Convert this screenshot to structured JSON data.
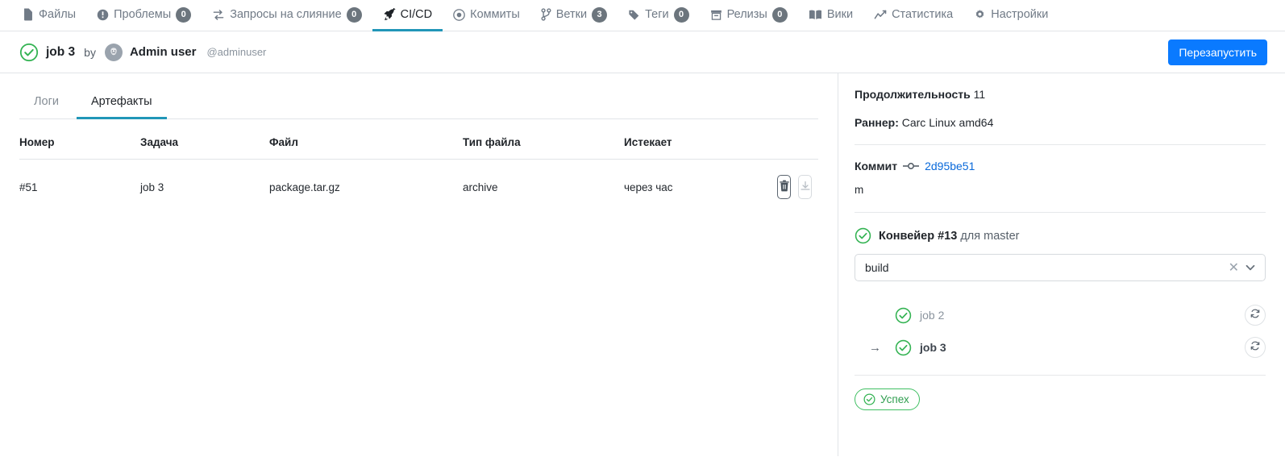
{
  "nav": {
    "items": [
      {
        "label": "Файлы",
        "icon": "file-icon",
        "badge": null,
        "active": false
      },
      {
        "label": "Проблемы",
        "icon": "issue-icon",
        "badge": "0",
        "active": false
      },
      {
        "label": "Запросы на слияние",
        "icon": "pull-request-icon",
        "badge": "0",
        "active": false
      },
      {
        "label": "CI/CD",
        "icon": "rocket-icon",
        "badge": null,
        "active": true
      },
      {
        "label": "Коммиты",
        "icon": "commit-dot-icon",
        "badge": null,
        "active": false
      },
      {
        "label": "Ветки",
        "icon": "branch-icon",
        "badge": "3",
        "active": false
      },
      {
        "label": "Теги",
        "icon": "tag-icon",
        "badge": "0",
        "active": false
      },
      {
        "label": "Релизы",
        "icon": "release-icon",
        "badge": "0",
        "active": false
      },
      {
        "label": "Вики",
        "icon": "book-icon",
        "badge": null,
        "active": false
      },
      {
        "label": "Статистика",
        "icon": "chart-icon",
        "badge": null,
        "active": false
      },
      {
        "label": "Настройки",
        "icon": "gear-icon",
        "badge": null,
        "active": false
      }
    ]
  },
  "header": {
    "status_icon": "check-circle-icon",
    "job_title": "job 3",
    "by": "by",
    "avatar_icon": "avatar-icon",
    "user_name": "Admin user",
    "user_handle": "@adminuser",
    "restart_label": "Перезапустить"
  },
  "tabs": [
    {
      "label": "Логи",
      "active": false
    },
    {
      "label": "Артефакты",
      "active": true
    }
  ],
  "artifacts": {
    "columns": [
      "Номер",
      "Задача",
      "Файл",
      "Тип файла",
      "Истекает",
      ""
    ],
    "rows": [
      {
        "number": "#51",
        "task": "job 3",
        "file": "package.tar.gz",
        "file_type": "archive",
        "expires": "через час",
        "delete_icon": "trash-icon",
        "download_icon": "download-icon"
      }
    ]
  },
  "sidebar": {
    "duration_label": "Продолжительность",
    "duration_value": "11",
    "runner_label": "Раннер:",
    "runner_value": "Carc Linux amd64",
    "commit_label": "Коммит",
    "commit_icon": "git-commit-icon",
    "commit_sha": "2d95be51",
    "commit_message": "m",
    "pipeline_status_icon": "check-circle-icon",
    "pipeline_title": "Конвейер #13",
    "pipeline_for": "для master",
    "stage_select": {
      "value": "build",
      "placeholder": "build",
      "clear_icon": "clear-icon",
      "chevron_icon": "chevron-down-icon"
    },
    "jobs": [
      {
        "name": "job 2",
        "status_icon": "check-circle-icon",
        "current": false,
        "arrow": "",
        "rerun_icon": "rerun-icon"
      },
      {
        "name": "job 3",
        "status_icon": "check-circle-icon",
        "current": true,
        "arrow": "→",
        "rerun_icon": "rerun-icon"
      }
    ],
    "status_badge": {
      "label": "Успех",
      "icon": "check-circle-icon"
    }
  },
  "colors": {
    "accent_teal": "#2196b8",
    "primary_blue": "#0a7aff",
    "link_blue": "#0969da",
    "success_green": "#34b353"
  }
}
